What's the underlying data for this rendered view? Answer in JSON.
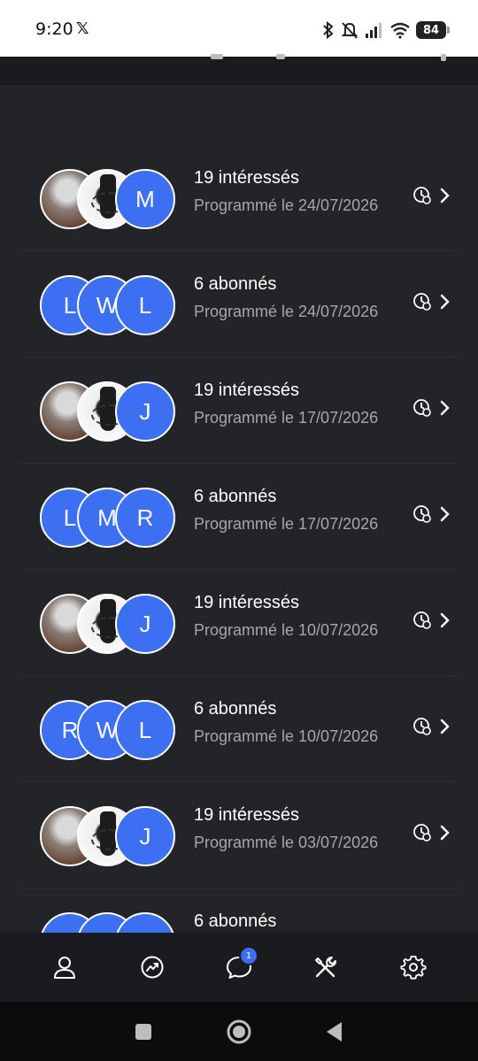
{
  "status_bar": {
    "time": "9:20",
    "battery": "84",
    "icons": [
      "x-app-icon",
      "bluetooth-icon",
      "mute-icon",
      "signal-icon",
      "wifi-icon",
      "battery-icon"
    ]
  },
  "list": {
    "rows": [
      {
        "title": "19 intéressés",
        "subtitle": "Programmé le 24/07/2026",
        "avatars": [
          "",
          "",
          "M"
        ]
      },
      {
        "title": "6 abonnés",
        "subtitle": "Programmé le 24/07/2026",
        "avatars": [
          "L",
          "W",
          "L"
        ]
      },
      {
        "title": "19 intéressés",
        "subtitle": "Programmé le 17/07/2026",
        "avatars": [
          "",
          "",
          "J"
        ]
      },
      {
        "title": "6 abonnés",
        "subtitle": "Programmé le 17/07/2026",
        "avatars": [
          "L",
          "M",
          "R"
        ]
      },
      {
        "title": "19 intéressés",
        "subtitle": "Programmé le 10/07/2026",
        "avatars": [
          "",
          "",
          "J"
        ]
      },
      {
        "title": "6 abonnés",
        "subtitle": "Programmé le 10/07/2026",
        "avatars": [
          "R",
          "W",
          "L"
        ]
      },
      {
        "title": "19 intéressés",
        "subtitle": "Programmé le 03/07/2026",
        "avatars": [
          "",
          "",
          "J"
        ]
      },
      {
        "title": "6 abonnés",
        "subtitle": "",
        "avatars": [
          "",
          "",
          ""
        ]
      }
    ]
  },
  "bottom_nav": {
    "items": [
      "profile-icon",
      "trending-icon",
      "chat-icon",
      "tools-icon",
      "settings-icon"
    ],
    "chat_badge": "1"
  },
  "colors": {
    "background": "#232427",
    "avatar": "#3d6ff2",
    "subtitle": "#a6a7ab",
    "nav": "#1a1b1e"
  }
}
